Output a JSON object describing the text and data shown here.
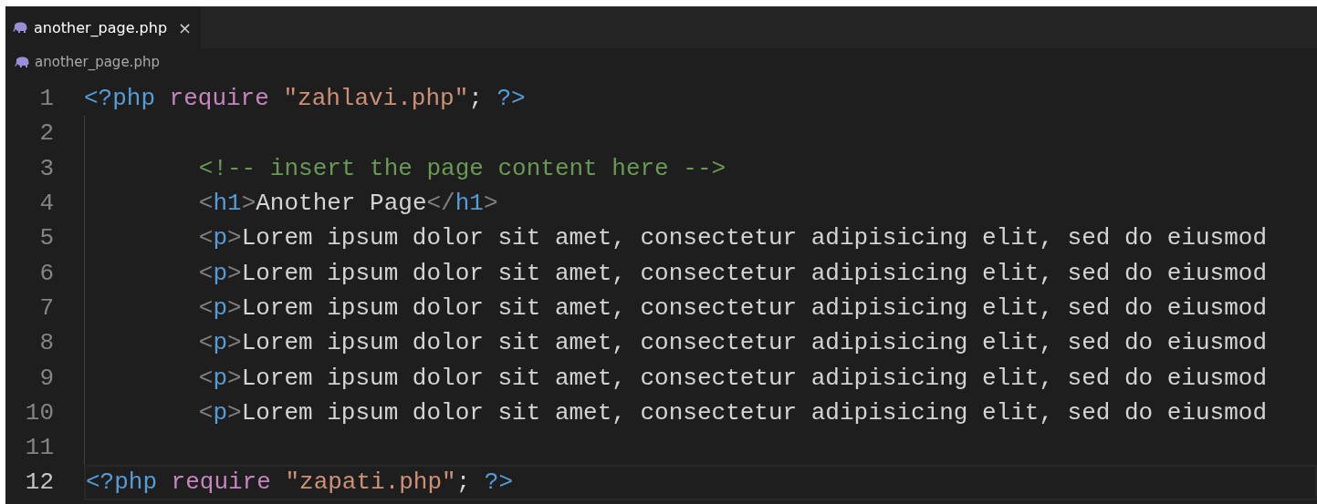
{
  "tabs": [
    {
      "label": "another_page.php",
      "close": "×",
      "selected": true
    }
  ],
  "breadcrumb": {
    "file": "another_page.php"
  },
  "lines": [
    {
      "number": "1",
      "current": false,
      "guide": false,
      "indent": false,
      "tokens": [
        {
          "kind": "php",
          "text": "<?php",
          "space": false
        },
        {
          "kind": "keyword",
          "text": "require",
          "space": true
        },
        {
          "kind": "string",
          "text": "\"zahlavi.php\"",
          "space": true
        },
        {
          "kind": "plain",
          "text": ";",
          "space": false
        },
        {
          "kind": "php",
          "text": "?>",
          "space": true
        }
      ]
    },
    {
      "number": "2",
      "current": false,
      "guide": true,
      "indent": false
    },
    {
      "number": "3",
      "current": false,
      "guide": true,
      "indent": true,
      "tokens": [
        {
          "kind": "comment",
          "text": "<!-- insert the page content here -->",
          "space": false
        }
      ]
    },
    {
      "number": "4",
      "current": false,
      "guide": true,
      "indent": true,
      "tokens": [
        {
          "kind": "punct",
          "text": "<",
          "space": false
        },
        {
          "kind": "tag",
          "text": "h1",
          "space": false
        },
        {
          "kind": "punct",
          "text": ">",
          "space": false
        },
        {
          "kind": "plain",
          "text": "Another Page",
          "space": false
        },
        {
          "kind": "punct",
          "text": "</",
          "space": false
        },
        {
          "kind": "tag",
          "text": "h1",
          "space": false
        },
        {
          "kind": "punct",
          "text": ">",
          "space": false
        }
      ]
    },
    {
      "number": "5",
      "current": false,
      "guide": true,
      "indent": true,
      "tokens": [
        {
          "kind": "punct",
          "text": "<",
          "space": false
        },
        {
          "kind": "tag",
          "text": "p",
          "space": false
        },
        {
          "kind": "punct",
          "text": ">",
          "space": false
        },
        {
          "kind": "plain",
          "text": "Lorem ipsum dolor sit amet, consectetur adipisicing elit, sed do eiusmod",
          "space": false
        }
      ]
    },
    {
      "number": "6",
      "current": false,
      "guide": true,
      "indent": true,
      "tokens": [
        {
          "kind": "punct",
          "text": "<",
          "space": false
        },
        {
          "kind": "tag",
          "text": "p",
          "space": false
        },
        {
          "kind": "punct",
          "text": ">",
          "space": false
        },
        {
          "kind": "plain",
          "text": "Lorem ipsum dolor sit amet, consectetur adipisicing elit, sed do eiusmod",
          "space": false
        }
      ]
    },
    {
      "number": "7",
      "current": false,
      "guide": true,
      "indent": true,
      "tokens": [
        {
          "kind": "punct",
          "text": "<",
          "space": false
        },
        {
          "kind": "tag",
          "text": "p",
          "space": false
        },
        {
          "kind": "punct",
          "text": ">",
          "space": false
        },
        {
          "kind": "plain",
          "text": "Lorem ipsum dolor sit amet, consectetur adipisicing elit, sed do eiusmod",
          "space": false
        }
      ]
    },
    {
      "number": "8",
      "current": false,
      "guide": true,
      "indent": true,
      "tokens": [
        {
          "kind": "punct",
          "text": "<",
          "space": false
        },
        {
          "kind": "tag",
          "text": "p",
          "space": false
        },
        {
          "kind": "punct",
          "text": ">",
          "space": false
        },
        {
          "kind": "plain",
          "text": "Lorem ipsum dolor sit amet, consectetur adipisicing elit, sed do eiusmod",
          "space": false
        }
      ]
    },
    {
      "number": "9",
      "current": false,
      "guide": true,
      "indent": true,
      "tokens": [
        {
          "kind": "punct",
          "text": "<",
          "space": false
        },
        {
          "kind": "tag",
          "text": "p",
          "space": false
        },
        {
          "kind": "punct",
          "text": ">",
          "space": false
        },
        {
          "kind": "plain",
          "text": "Lorem ipsum dolor sit amet, consectetur adipisicing elit, sed do eiusmod",
          "space": false
        }
      ]
    },
    {
      "number": "10",
      "current": false,
      "guide": true,
      "indent": true,
      "tokens": [
        {
          "kind": "punct",
          "text": "<",
          "space": false
        },
        {
          "kind": "tag",
          "text": "p",
          "space": false
        },
        {
          "kind": "punct",
          "text": ">",
          "space": false
        },
        {
          "kind": "plain",
          "text": "Lorem ipsum dolor sit amet, consectetur adipisicing elit, sed do eiusmod",
          "space": false
        }
      ]
    },
    {
      "number": "11",
      "current": false,
      "guide": true,
      "indent": false
    },
    {
      "number": "12",
      "current": true,
      "guide": false,
      "indent": false,
      "tokens": [
        {
          "kind": "php",
          "text": "<?php",
          "space": false
        },
        {
          "kind": "keyword",
          "text": "require",
          "space": true
        },
        {
          "kind": "string",
          "text": "\"zapati.php\"",
          "space": true
        },
        {
          "kind": "plain",
          "text": ";",
          "space": false
        },
        {
          "kind": "php",
          "text": "?>",
          "space": true
        }
      ]
    }
  ]
}
